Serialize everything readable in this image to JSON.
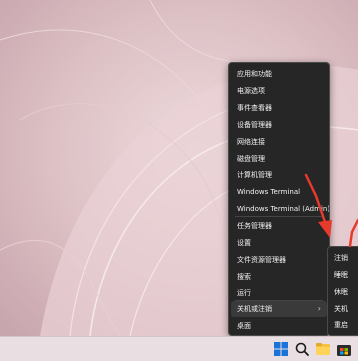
{
  "menu": {
    "items": [
      {
        "label": "应用和功能"
      },
      {
        "label": "电源选项"
      },
      {
        "label": "事件查看器"
      },
      {
        "label": "设备管理器"
      },
      {
        "label": "网络连接"
      },
      {
        "label": "磁盘管理"
      },
      {
        "label": "计算机管理"
      },
      {
        "label": "Windows Terminal"
      },
      {
        "label": "Windows Terminal (Admin)"
      },
      {
        "label": "任务管理器"
      },
      {
        "label": "设置"
      },
      {
        "label": "文件资源管理器"
      },
      {
        "label": "搜索"
      },
      {
        "label": "运行"
      },
      {
        "label": "关机或注销"
      },
      {
        "label": "桌面"
      }
    ],
    "chevron": "›"
  },
  "submenu": {
    "items": [
      {
        "label": "注销"
      },
      {
        "label": "睡眠"
      },
      {
        "label": "休眠"
      },
      {
        "label": "关机"
      },
      {
        "label": "重启"
      }
    ]
  },
  "taskbar": {
    "icons": [
      "windows-start-icon",
      "search-icon",
      "file-explorer-icon",
      "store-icon"
    ]
  },
  "colors": {
    "menu_bg": "#262626",
    "menu_text": "#f2f2f2",
    "arrow_red": "#e53a2c",
    "wallpaper": "#dcc3c6"
  }
}
